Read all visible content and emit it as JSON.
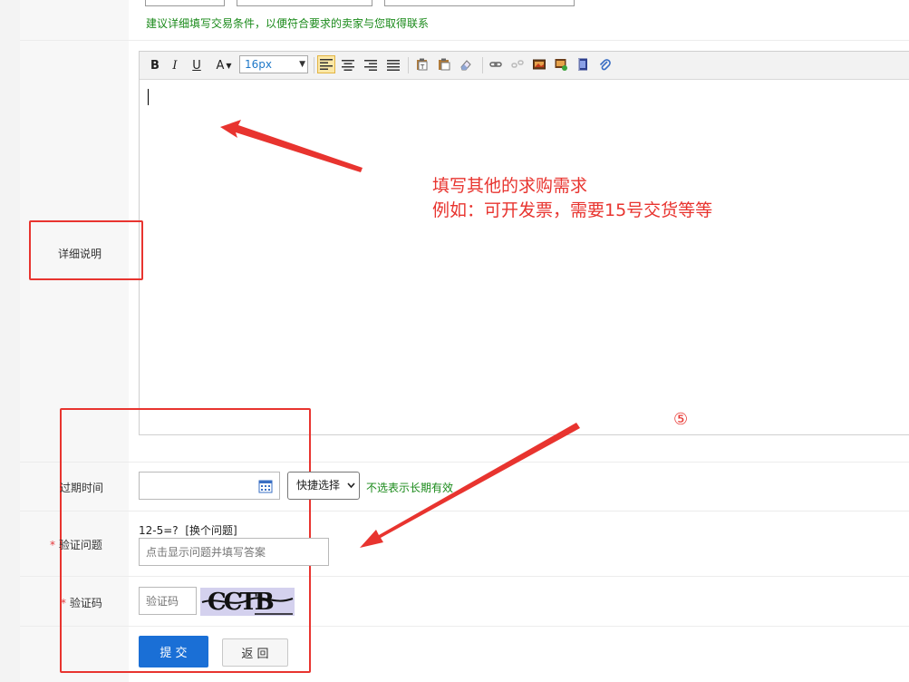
{
  "form": {
    "hint_trade": "建议详细填写交易条件，以便符合要求的卖家与您取得联系",
    "detail_label": "详细说明",
    "expire_label": "过期时间",
    "expire_quick_select": "快捷选择",
    "expire_hint": "不选表示长期有效",
    "verify_label": "验证问题",
    "verify_question": "12-5=?",
    "verify_change": "[换个问题]",
    "verify_placeholder": "点击显示问题并填写答案",
    "captcha_label": "验证码",
    "captcha_placeholder": "验证码",
    "captcha_text": "CCTB",
    "required_mark": "*",
    "submit_label": "提 交",
    "back_label": "返 回"
  },
  "editor": {
    "bold": "B",
    "italic": "I",
    "underline": "U",
    "font_color": "A",
    "font_size": "16px",
    "icons": [
      "bold-icon",
      "italic-icon",
      "underline-icon",
      "font-color-icon",
      "align-left-icon",
      "align-center-icon",
      "align-right-icon",
      "align-justify-icon",
      "paste-text-icon",
      "paste-word-icon",
      "eraser-icon",
      "link-icon",
      "unlink-icon",
      "image-icon",
      "gallery-icon",
      "video-icon",
      "attachment-icon"
    ]
  },
  "annotation": {
    "line1": "填写其他的求购需求",
    "line2": "例如：可开发票，需要15号交货等等",
    "step": "⑤"
  },
  "colors": {
    "annotation_red": "#e8342f",
    "hint_green": "#1a8a1a",
    "primary_blue": "#1a6fd6"
  }
}
